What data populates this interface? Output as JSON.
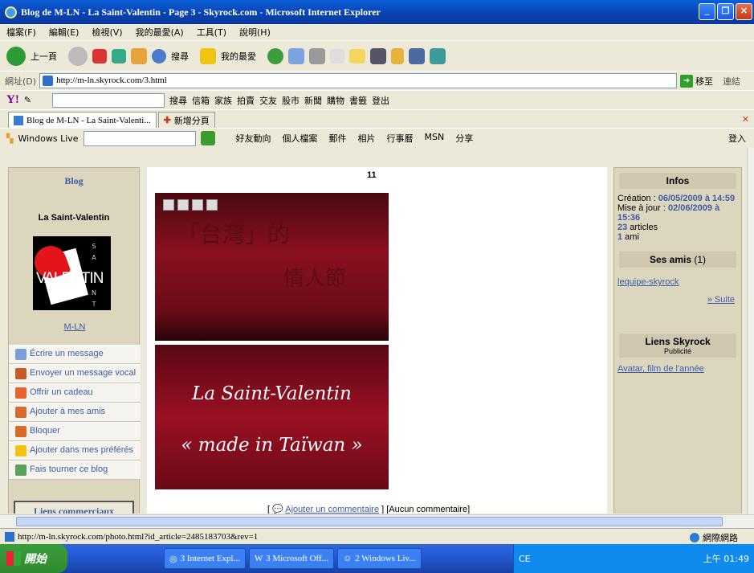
{
  "window": {
    "title": "Blog de M-LN - La Saint-Valentin - Page 3 - Skyrock.com - Microsoft Internet Explorer"
  },
  "menubar": [
    "檔案(F)",
    "編輯(E)",
    "檢視(V)",
    "我的最愛(A)",
    "工具(T)",
    "說明(H)"
  ],
  "toolbar": {
    "back": "上一頁",
    "search": "搜尋",
    "favorites": "我的最愛"
  },
  "address": {
    "label": "網址(D)",
    "url": "http://m-ln.skyrock.com/3.html",
    "go": "移至",
    "links": "連結"
  },
  "yahoo": {
    "search_btn": "搜尋",
    "items": [
      "信箱",
      "家族",
      "拍賣",
      "交友",
      "股市",
      "新聞",
      "購物",
      "書籤",
      "登出"
    ]
  },
  "tabs": {
    "active": "Blog de M-LN - La Saint-Valenti...",
    "new_tab": "新增分頁"
  },
  "live": {
    "brand": "Windows Live",
    "links": [
      "好友動向",
      "個人檔案",
      "郵件",
      "相片",
      "行事曆",
      "MSN",
      "分享"
    ],
    "signin": "登入"
  },
  "left": {
    "blog_label": "Blog",
    "blog_name": "La Saint-Valentin",
    "avatar_word": "VALENTIN",
    "avatar_letters": [
      "S",
      "A",
      "N",
      "T"
    ],
    "owner": "M-LN",
    "menu": [
      "Écrire un message",
      "Envoyer un message vocal",
      "Offrir un cadeau",
      "Ajouter à mes amis",
      "Bloquer",
      "Ajouter dans mes préférés",
      "Fais tourner ce blog"
    ],
    "liens_commerciaux": "Liens commerciaux"
  },
  "post": {
    "number": "11",
    "img1_line1": "「台灣」的",
    "img1_line2": "情人節",
    "img2_line1": "La Saint-Valentin",
    "img2_line2": "« made in Taïwan »",
    "comment_link": "Ajouter un commentaire",
    "no_comment": "[Aucun commentaire]"
  },
  "right": {
    "infos_title": "Infos",
    "creation_label": "Création : ",
    "creation_value": "06/05/2009 à 14:59",
    "update_label": "Mise à jour : ",
    "update_value": "02/06/2009 à 15:36",
    "articles_count": "23",
    "articles_label": " articles",
    "friends_count": "1",
    "friends_label": " ami",
    "ses_amis": "Ses amis",
    "ses_amis_count": "(1)",
    "friend_link": "lequipe-skyrock",
    "suite": "» Suite",
    "liens_title": "Liens Skyrock",
    "publicite": "Publicité",
    "ad_link": "Avatar, film de l'année"
  },
  "status": {
    "url": "http://m-ln.skyrock.com/photo.html?id_article=2485183703&rev=1",
    "zone": "網際網路"
  },
  "taskbar": {
    "start": "開始",
    "tasks": [
      "3 Internet Expl...",
      "3 Microsoft Off...",
      "2 Windows Liv..."
    ],
    "lang": "CE",
    "time": "上午 01:49"
  }
}
